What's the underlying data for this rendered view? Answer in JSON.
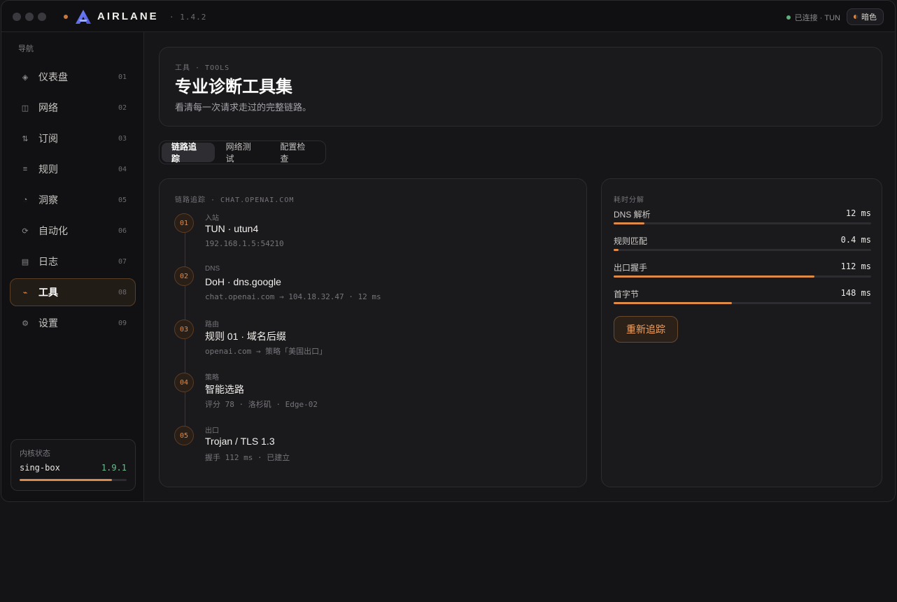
{
  "app": {
    "brand": "AIRLANE",
    "version": "· 1.4.2",
    "status": "已连接 · TUN",
    "theme_label": "暗色",
    "accent": "#e08a48"
  },
  "sidebar": {
    "heading": "导航",
    "items": [
      {
        "label": "仪表盘",
        "num": "01",
        "icon": "dashboard-icon",
        "glyph": "◈"
      },
      {
        "label": "网络",
        "num": "02",
        "icon": "network-icon",
        "glyph": "◫"
      },
      {
        "label": "订阅",
        "num": "03",
        "icon": "subscription-icon",
        "glyph": "⇅"
      },
      {
        "label": "规则",
        "num": "04",
        "icon": "rules-icon",
        "glyph": "≡"
      },
      {
        "label": "洞察",
        "num": "05",
        "icon": "insight-icon",
        "glyph": "◔"
      },
      {
        "label": "自动化",
        "num": "06",
        "icon": "automation-icon",
        "glyph": "⟳"
      },
      {
        "label": "日志",
        "num": "07",
        "icon": "log-icon",
        "glyph": "▤"
      },
      {
        "label": "工具",
        "num": "08",
        "icon": "tools-icon",
        "glyph": "⌁",
        "active": true
      },
      {
        "label": "设置",
        "num": "09",
        "icon": "settings-icon",
        "glyph": "⚙"
      }
    ],
    "kernel": {
      "heading": "内核状态",
      "name": "sing-box",
      "version": "1.9.1",
      "progress": 0.86
    }
  },
  "header": {
    "eyebrow": "工具 · TOOLS",
    "title": "专业诊断工具集",
    "subtitle": "看清每一次请求走过的完整链路。"
  },
  "tabs": [
    "链路追踪",
    "网络测试",
    "配置检查"
  ],
  "trace": {
    "eyebrow": "链路追踪 · CHAT.OPENAI.COM",
    "steps": [
      {
        "num": "01",
        "kind": "入站",
        "title": "TUN · utun4",
        "detail": "192.168.1.5:54210"
      },
      {
        "num": "02",
        "kind": "DNS",
        "title": "DoH · dns.google",
        "detail": "chat.openai.com → 104.18.32.47 · 12 ms"
      },
      {
        "num": "03",
        "kind": "路由",
        "title": "规则 01 · 域名后缀",
        "detail": "openai.com → 策略「美国出口」"
      },
      {
        "num": "04",
        "kind": "策略",
        "title": "智能选路",
        "detail": "评分 78 · 洛杉矶 · Edge-02"
      },
      {
        "num": "05",
        "kind": "出口",
        "title": "Trojan / TLS 1.3",
        "detail": "握手 112 ms · 已建立"
      }
    ]
  },
  "timing": {
    "eyebrow": "耗时分解",
    "rows": [
      {
        "label": "DNS 解析",
        "value": "12 ms",
        "fraction": 0.12
      },
      {
        "label": "规则匹配",
        "value": "0.4 ms",
        "fraction": 0.02
      },
      {
        "label": "出口握手",
        "value": "112 ms",
        "fraction": 0.78
      },
      {
        "label": "首字节",
        "value": "148 ms",
        "fraction": 0.46
      }
    ],
    "retrace_label": "重新追踪"
  }
}
